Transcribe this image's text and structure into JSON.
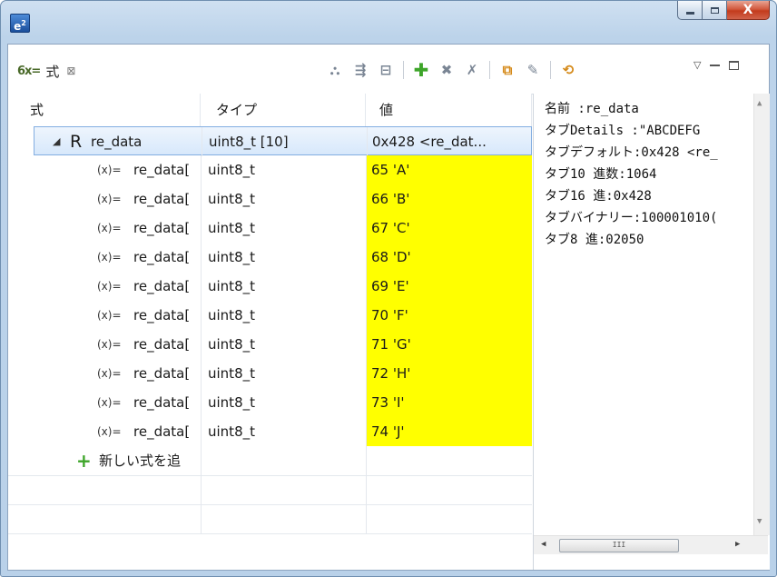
{
  "window": {
    "logo_text": "e",
    "logo_sup": "2",
    "close_glyph": "X"
  },
  "view": {
    "tab_icon": "6x=",
    "tab_label": "式",
    "tab_close": "⊠",
    "toolbar_icons": [
      "show-type-icon",
      "collapse-all-icon",
      "expand-all-icon",
      "add-expression-icon",
      "remove-expression-icon",
      "remove-all-icon",
      "export-icon",
      "edit-icon",
      "refresh-icon"
    ]
  },
  "table": {
    "headers": [
      "式",
      "タイプ",
      "値"
    ],
    "parent": {
      "marker": "◢",
      "icon": "R",
      "name": "re_data",
      "type": "uint8_t [10]",
      "value": "0x428 <re_dat..."
    },
    "children": [
      {
        "icon": "(x)=",
        "name": "re_data[",
        "type": "uint8_t",
        "value": "65 'A'"
      },
      {
        "icon": "(x)=",
        "name": "re_data[",
        "type": "uint8_t",
        "value": "66 'B'"
      },
      {
        "icon": "(x)=",
        "name": "re_data[",
        "type": "uint8_t",
        "value": "67 'C'"
      },
      {
        "icon": "(x)=",
        "name": "re_data[",
        "type": "uint8_t",
        "value": "68 'D'"
      },
      {
        "icon": "(x)=",
        "name": "re_data[",
        "type": "uint8_t",
        "value": "69 'E'"
      },
      {
        "icon": "(x)=",
        "name": "re_data[",
        "type": "uint8_t",
        "value": "70 'F'"
      },
      {
        "icon": "(x)=",
        "name": "re_data[",
        "type": "uint8_t",
        "value": "71 'G'"
      },
      {
        "icon": "(x)=",
        "name": "re_data[",
        "type": "uint8_t",
        "value": "72 'H'"
      },
      {
        "icon": "(x)=",
        "name": "re_data[",
        "type": "uint8_t",
        "value": "73 'I'"
      },
      {
        "icon": "(x)=",
        "name": "re_data[",
        "type": "uint8_t",
        "value": "74 'J'"
      }
    ],
    "add_row": {
      "icon": "+",
      "label": "新しい式を追"
    }
  },
  "details": {
    "lines": [
      "名前 :re_data",
      "タブDetails :\"ABCDEFG",
      "タブデフォルト:0x428 <re_",
      "タブ10 進数:1064",
      "タブ16 進:0x428",
      "タブバイナリー:100001010(",
      "タブ8 進:02050"
    ],
    "scroll_thumb_label": "III"
  },
  "colors": {
    "value_highlight": "#ffff00",
    "selection": "#d7e8fb",
    "add_icon": "#3ea52a"
  }
}
